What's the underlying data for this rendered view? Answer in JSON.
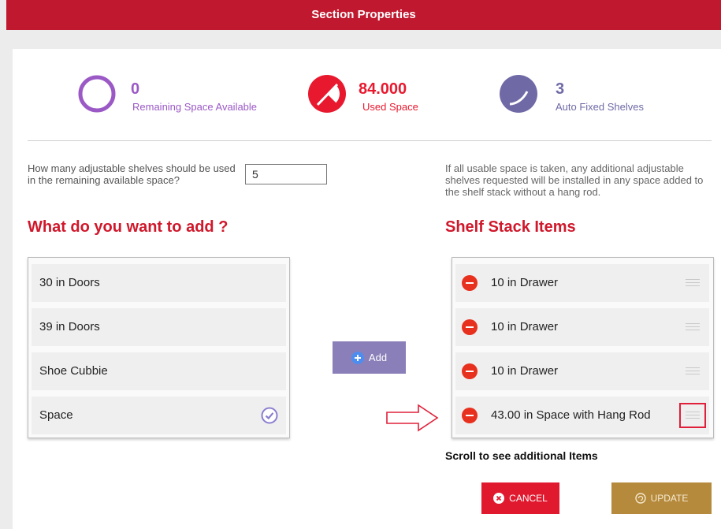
{
  "header": {
    "title": "Section Properties"
  },
  "stats": [
    {
      "value": "0",
      "label": "Remaining Space Available",
      "color": "#9b59c6"
    },
    {
      "value": "84.000",
      "label": "Used Space",
      "color": "#e8192f"
    },
    {
      "value": "3",
      "label": "Auto Fixed Shelves",
      "color": "#6f6aa6"
    }
  ],
  "question": {
    "text": "How many adjustable shelves should be used in the remaining available space?",
    "value": "5"
  },
  "info_text": "If all usable space is taken, any additional adjustable shelves requested will be installed in any space added to the shelf stack without a hang rod.",
  "left": {
    "title": "What do you want to add ?",
    "items": [
      "30 in Doors",
      "39 in Doors",
      "Shoe Cubbie",
      "Space"
    ]
  },
  "right": {
    "title": "Shelf Stack Items",
    "items": [
      "10 in Drawer",
      "10 in Drawer",
      "10 in Drawer",
      "43.00 in Space with Hang Rod"
    ]
  },
  "add_button": {
    "label": "Add"
  },
  "scroll_note": "Scroll to see additional Items",
  "cancel_button": {
    "label": "CANCEL"
  },
  "update_button": {
    "label": "UPDATE"
  },
  "icons": {
    "check": "check-circle-icon",
    "remove": "minus-circle-icon",
    "drag": "drag-handle-icon",
    "add": "plus-circle-icon",
    "cancel": "x-circle-icon",
    "update": "refresh-icon"
  }
}
